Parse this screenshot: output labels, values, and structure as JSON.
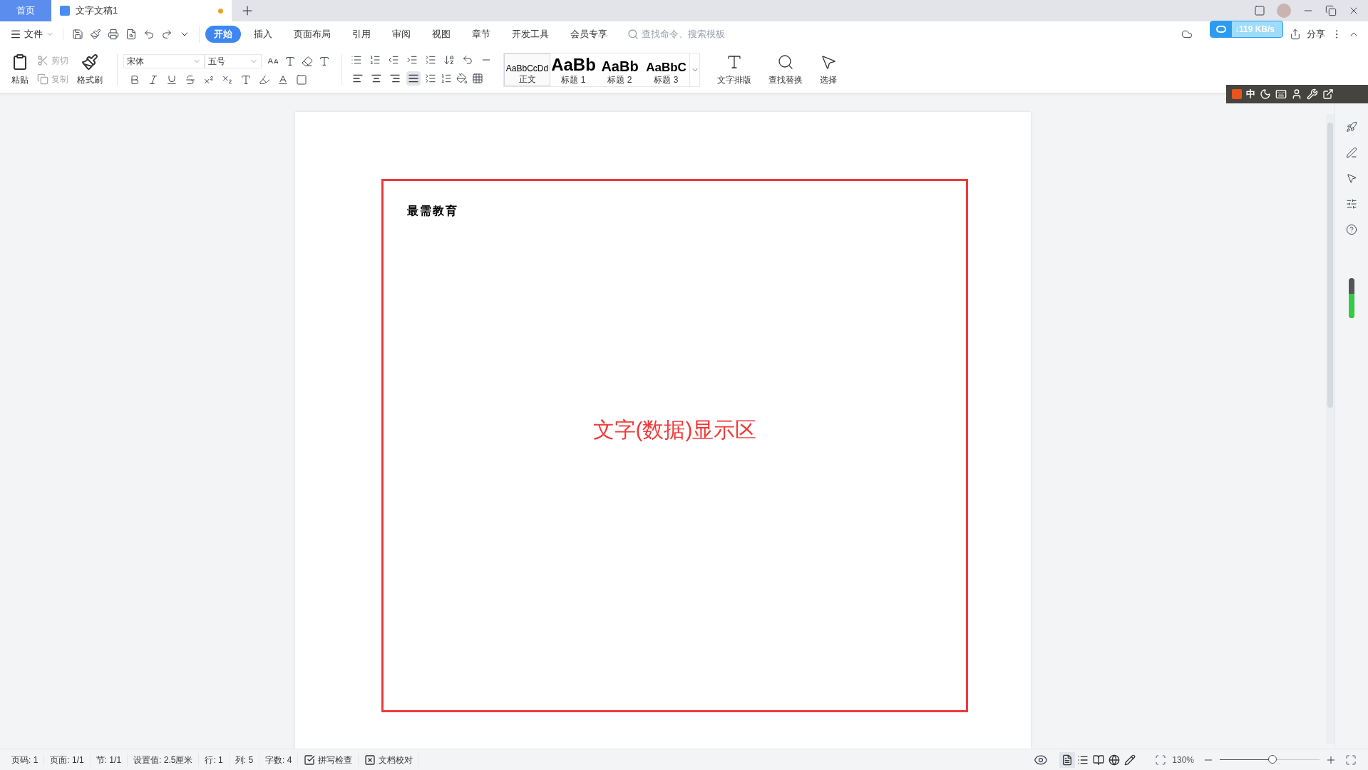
{
  "tabs": [
    {
      "label": "首页",
      "kind": "home"
    },
    {
      "label": "文字文稿1",
      "kind": "document",
      "modified": true
    }
  ],
  "menu": {
    "file_label": "文件",
    "ribbon_tabs": [
      {
        "label": "开始",
        "selected": true
      },
      {
        "label": "插入",
        "selected": false
      },
      {
        "label": "页面布局",
        "selected": false
      },
      {
        "label": "引用",
        "selected": false
      },
      {
        "label": "审阅",
        "selected": false
      },
      {
        "label": "视图",
        "selected": false
      },
      {
        "label": "章节",
        "selected": false
      },
      {
        "label": "开发工具",
        "selected": false
      },
      {
        "label": "会员专享",
        "selected": false
      }
    ],
    "search": {
      "placeholder": "查找命令、搜索模板"
    },
    "share": "分享"
  },
  "download_widget": {
    "speed": "↓119 KB/s"
  },
  "ime_toolbar": {
    "mode": "中"
  },
  "ribbon": {
    "paste": "粘贴",
    "cut": {
      "label": "剪切",
      "disabled": true
    },
    "copy": {
      "label": "复制",
      "disabled": true
    },
    "format_painter": "格式刷",
    "font": {
      "family": "宋体",
      "size": "五号"
    },
    "alignment": [
      {
        "kind": "left",
        "selected": false
      },
      {
        "kind": "center",
        "selected": false
      },
      {
        "kind": "right",
        "selected": false
      },
      {
        "kind": "justify",
        "selected": true
      }
    ],
    "styles": [
      {
        "preview": "AaBbCcDd",
        "label": "正文",
        "kind": "body",
        "selected": true
      },
      {
        "preview": "AaBb",
        "label": "标题 1",
        "kind": "h1",
        "selected": false
      },
      {
        "preview": "AaBb",
        "label": "标题 2",
        "kind": "h2",
        "selected": false
      },
      {
        "preview": "AaBbC",
        "label": "标题 3",
        "kind": "h3",
        "selected": false
      }
    ],
    "tools": [
      {
        "label": "文字排版",
        "kind": "layout"
      },
      {
        "label": "查找替换",
        "kind": "find"
      },
      {
        "label": "选择",
        "kind": "select"
      }
    ]
  },
  "document": {
    "lines": [
      "最需教育"
    ],
    "annotation": "文字(数据)显示区"
  },
  "status_bar": {
    "items": [
      "页码: 1",
      "页面: 1/1",
      "节: 1/1",
      "设置值: 2.5厘米",
      "行: 1",
      "列: 5",
      "字数: 4"
    ],
    "toggles": [
      {
        "label": "拼写检查",
        "checked": true
      },
      {
        "label": "文档校对",
        "checked": false
      }
    ],
    "views": [
      {
        "kind": "page",
        "selected": true
      },
      {
        "kind": "outline",
        "selected": false
      },
      {
        "kind": "read",
        "selected": false
      },
      {
        "kind": "web",
        "selected": false
      },
      {
        "kind": "write",
        "selected": false
      }
    ],
    "zoom": "130%",
    "zoom_slider": {
      "level": 0.53
    }
  }
}
